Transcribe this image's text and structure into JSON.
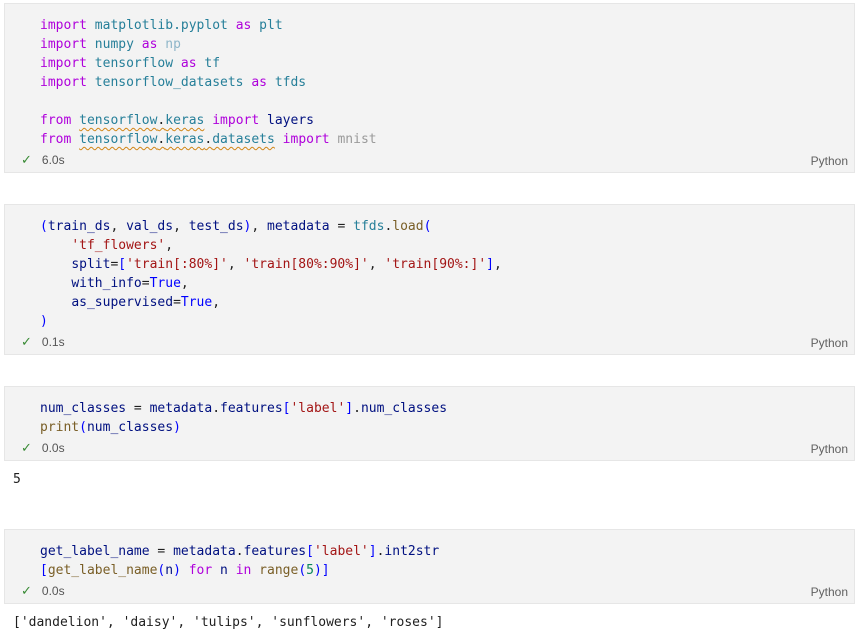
{
  "language_label": "Python",
  "cells": [
    {
      "status": "6.0s",
      "lines": [
        [
          [
            "kw",
            "import"
          ],
          [
            "t",
            " "
          ],
          [
            "mod",
            "matplotlib.pyplot"
          ],
          [
            "t",
            " "
          ],
          [
            "kw",
            "as"
          ],
          [
            "t",
            " "
          ],
          [
            "mod",
            "plt"
          ]
        ],
        [
          [
            "kw",
            "import"
          ],
          [
            "t",
            " "
          ],
          [
            "mod",
            "numpy"
          ],
          [
            "t",
            " "
          ],
          [
            "kw",
            "as"
          ],
          [
            "t",
            " "
          ],
          [
            "mod-dim",
            "np"
          ]
        ],
        [
          [
            "kw",
            "import"
          ],
          [
            "t",
            " "
          ],
          [
            "mod",
            "tensorflow"
          ],
          [
            "t",
            " "
          ],
          [
            "kw",
            "as"
          ],
          [
            "t",
            " "
          ],
          [
            "mod",
            "tf"
          ]
        ],
        [
          [
            "kw",
            "import"
          ],
          [
            "t",
            " "
          ],
          [
            "mod",
            "tensorflow_datasets"
          ],
          [
            "t",
            " "
          ],
          [
            "kw",
            "as"
          ],
          [
            "t",
            " "
          ],
          [
            "mod",
            "tfds"
          ]
        ],
        [],
        [
          [
            "kw",
            "from"
          ],
          [
            "t",
            " "
          ],
          [
            "mod squig",
            "tensorflow"
          ],
          [
            "t squig",
            "."
          ],
          [
            "mod squig",
            "keras"
          ],
          [
            "t",
            " "
          ],
          [
            "kw",
            "import"
          ],
          [
            "t",
            " "
          ],
          [
            "var",
            "layers"
          ]
        ],
        [
          [
            "kw",
            "from"
          ],
          [
            "t",
            " "
          ],
          [
            "mod squig",
            "tensorflow"
          ],
          [
            "t squig",
            "."
          ],
          [
            "mod squig",
            "keras"
          ],
          [
            "t squig",
            "."
          ],
          [
            "mod squig",
            "datasets"
          ],
          [
            "t",
            " "
          ],
          [
            "kw",
            "import"
          ],
          [
            "t",
            " "
          ],
          [
            "dim",
            "mnist"
          ]
        ]
      ],
      "output": ""
    },
    {
      "status": "0.1s",
      "lines": [
        [
          [
            "cst",
            "("
          ],
          [
            "var",
            "train_ds"
          ],
          [
            "t",
            ", "
          ],
          [
            "var",
            "val_ds"
          ],
          [
            "t",
            ", "
          ],
          [
            "var",
            "test_ds"
          ],
          [
            "cst",
            ")"
          ],
          [
            "t",
            ", "
          ],
          [
            "var",
            "metadata"
          ],
          [
            "t",
            " = "
          ],
          [
            "mod",
            "tfds"
          ],
          [
            "t",
            "."
          ],
          [
            "fn",
            "load"
          ],
          [
            "cst",
            "("
          ]
        ],
        [
          [
            "t",
            "    "
          ],
          [
            "str",
            "'tf_flowers'"
          ],
          [
            "t",
            ","
          ]
        ],
        [
          [
            "t",
            "    "
          ],
          [
            "var",
            "split"
          ],
          [
            "t",
            "="
          ],
          [
            "cst",
            "["
          ],
          [
            "str",
            "'train[:80%]'"
          ],
          [
            "t",
            ", "
          ],
          [
            "str",
            "'train[80%:90%]'"
          ],
          [
            "t",
            ", "
          ],
          [
            "str",
            "'train[90%:]'"
          ],
          [
            "cst",
            "]"
          ],
          [
            "t",
            ","
          ]
        ],
        [
          [
            "t",
            "    "
          ],
          [
            "var",
            "with_info"
          ],
          [
            "t",
            "="
          ],
          [
            "cst",
            "True"
          ],
          [
            "t",
            ","
          ]
        ],
        [
          [
            "t",
            "    "
          ],
          [
            "var",
            "as_supervised"
          ],
          [
            "t",
            "="
          ],
          [
            "cst",
            "True"
          ],
          [
            "t",
            ","
          ]
        ],
        [
          [
            "cst",
            ")"
          ]
        ]
      ],
      "output": ""
    },
    {
      "status": "0.0s",
      "lines": [
        [
          [
            "var",
            "num_classes"
          ],
          [
            "t",
            " = "
          ],
          [
            "var",
            "metadata"
          ],
          [
            "t",
            "."
          ],
          [
            "var",
            "features"
          ],
          [
            "cst",
            "["
          ],
          [
            "str",
            "'label'"
          ],
          [
            "cst",
            "]"
          ],
          [
            "t",
            "."
          ],
          [
            "var",
            "num_classes"
          ]
        ],
        [
          [
            "fn",
            "print"
          ],
          [
            "cst",
            "("
          ],
          [
            "var",
            "num_classes"
          ],
          [
            "cst",
            ")"
          ]
        ]
      ],
      "output": "5"
    },
    {
      "status": "0.0s",
      "lines": [
        [
          [
            "var",
            "get_label_name"
          ],
          [
            "t",
            " = "
          ],
          [
            "var",
            "metadata"
          ],
          [
            "t",
            "."
          ],
          [
            "var",
            "features"
          ],
          [
            "cst",
            "["
          ],
          [
            "str",
            "'label'"
          ],
          [
            "cst",
            "]"
          ],
          [
            "t",
            "."
          ],
          [
            "var",
            "int2str"
          ]
        ],
        [
          [
            "cst",
            "["
          ],
          [
            "fn",
            "get_label_name"
          ],
          [
            "cst",
            "("
          ],
          [
            "var",
            "n"
          ],
          [
            "cst",
            ")"
          ],
          [
            "t",
            " "
          ],
          [
            "kw",
            "for"
          ],
          [
            "t",
            " "
          ],
          [
            "var",
            "n"
          ],
          [
            "t",
            " "
          ],
          [
            "kw",
            "in"
          ],
          [
            "t",
            " "
          ],
          [
            "fn",
            "range"
          ],
          [
            "cst",
            "("
          ],
          [
            "num",
            "5"
          ],
          [
            "cst",
            ")"
          ],
          [
            "cst",
            "]"
          ]
        ]
      ],
      "output": "['dandelion', 'daisy', 'tulips', 'sunflowers', 'roses']"
    }
  ]
}
